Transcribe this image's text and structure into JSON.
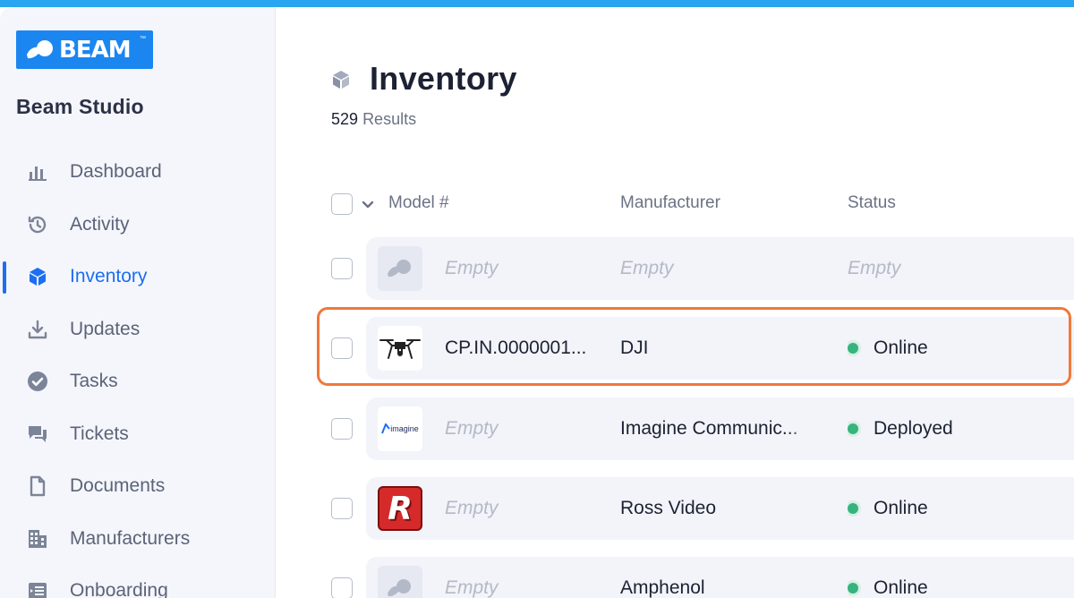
{
  "app": {
    "logo_text": "BEAM",
    "logo_tm": "™",
    "studio_name": "Beam Studio",
    "accent_color": "#1b6ff0",
    "top_bar_color": "#2aa6f0"
  },
  "sidebar": {
    "items": [
      {
        "label": "Dashboard",
        "icon": "bar-chart-icon",
        "active": false
      },
      {
        "label": "Activity",
        "icon": "history-icon",
        "active": false
      },
      {
        "label": "Inventory",
        "icon": "cube-icon",
        "active": true
      },
      {
        "label": "Updates",
        "icon": "download-icon",
        "active": false
      },
      {
        "label": "Tasks",
        "icon": "check-circle-icon",
        "active": false
      },
      {
        "label": "Tickets",
        "icon": "chat-bubbles-icon",
        "active": false
      },
      {
        "label": "Documents",
        "icon": "document-icon",
        "active": false
      },
      {
        "label": "Manufacturers",
        "icon": "building-icon",
        "active": false
      },
      {
        "label": "Onboarding",
        "icon": "onboarding-icon",
        "active": false
      }
    ]
  },
  "page": {
    "title": "Inventory",
    "title_icon": "cube-icon",
    "results_count": "529",
    "results_label": "Results"
  },
  "table": {
    "columns": [
      "Model #",
      "Manufacturer",
      "Status"
    ],
    "status_color": "#36b37e",
    "highlight_color": "#f0783a",
    "rows": [
      {
        "thumb": "beam-placeholder-logo",
        "model": "Empty",
        "manufacturer": "Empty",
        "status": "Empty"
      },
      {
        "thumb": "drone-icon",
        "model": "CP.IN.0000001...",
        "manufacturer": "DJI",
        "status": "Online",
        "highlighted": true
      },
      {
        "thumb": "imagine-logo",
        "thumb_text": "imagine",
        "model": "Empty",
        "manufacturer": "Imagine Communic...",
        "status": "Deployed"
      },
      {
        "thumb": "ross-logo",
        "thumb_text": "R",
        "model": "Empty",
        "manufacturer": "Ross Video",
        "status": "Online"
      },
      {
        "thumb": "beam-placeholder-logo",
        "model": "Empty",
        "manufacturer": "Amphenol",
        "status": "Online"
      }
    ]
  }
}
